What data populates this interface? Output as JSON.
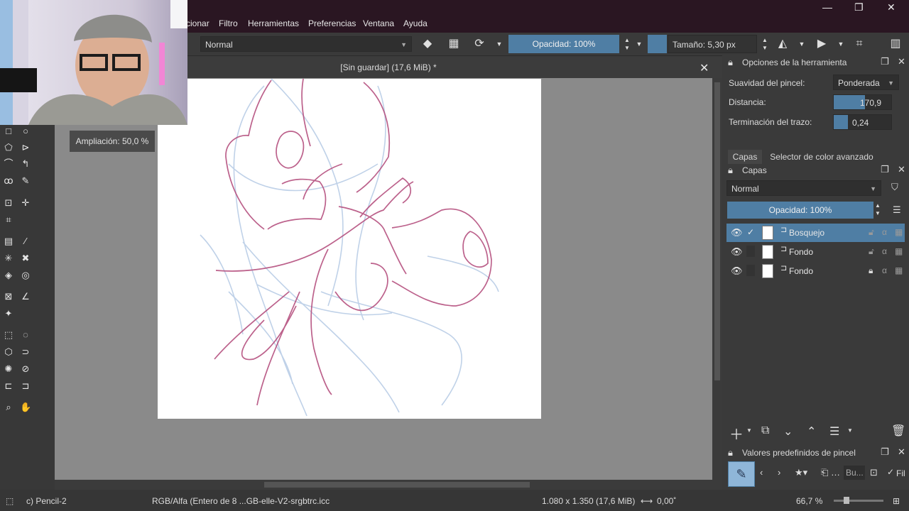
{
  "menu": [
    "cionar",
    "Filtro",
    "Herramientas",
    "Preferencias",
    "Ventana",
    "Ayuda"
  ],
  "toolbar": {
    "blend_mode": "Normal",
    "opacity_label": "Opacidad: 100%",
    "size_label": "Tamaño: 5,30 px"
  },
  "document": {
    "title": "[Sin guardar]  (17,6 MiB) *"
  },
  "zoom_tooltip": "Ampliación: 50,0 %",
  "tool_options": {
    "title": "Opciones de la herramienta",
    "smoothing_label": "Suavidad del pincel:",
    "smoothing_value": "Ponderada",
    "distance_label": "Distancia:",
    "distance_value": "170,9",
    "stroke_end_label": "Terminación del trazo:",
    "stroke_end_value": "0,24"
  },
  "dock_tabs": [
    "Capas",
    "Selector de color avanzado"
  ],
  "layers": {
    "title": "Capas",
    "blend_mode": "Normal",
    "opacity_label": "Opacidad:  100%",
    "items": [
      {
        "name": "Bosquejo",
        "selected": true
      },
      {
        "name": "Fondo",
        "selected": false
      },
      {
        "name": "Fondo",
        "selected": false,
        "locked": true
      }
    ]
  },
  "brush_presets": {
    "title": "Valores predefinidos de pincel",
    "search_placeholder": "Bu...",
    "filter_label": "Fil"
  },
  "status": {
    "brush": "c) Pencil-2",
    "color_profile": "RGB/Alfa (Entero de 8 ...GB-elle-V2-srgbtrc.icc",
    "dimensions": "1.080 x 1.350 (17,6 MiB)",
    "rotation": "0,00˚",
    "zoom": "66,7 %"
  },
  "colors": {
    "accent": "#4f7ea4",
    "selected_layer": "#4f7ea4",
    "canvas_bg": "#8a8a8a"
  }
}
